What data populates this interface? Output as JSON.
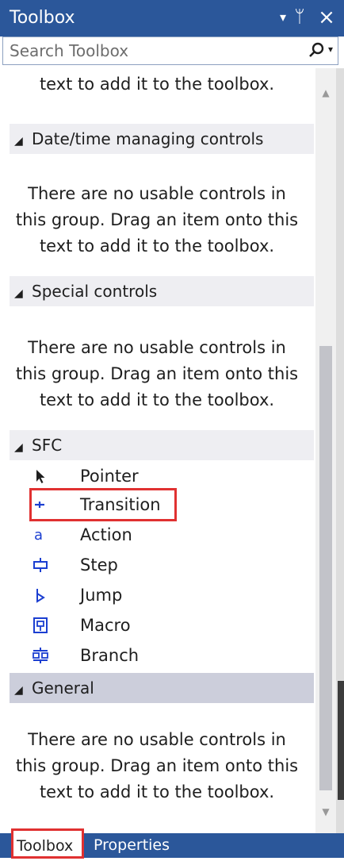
{
  "panel": {
    "title": "Toolbox",
    "menu_icon": "▾",
    "pin_icon": "ᛘ",
    "close_icon": "×"
  },
  "search": {
    "placeholder": "Search Toolbox",
    "value": ""
  },
  "content": {
    "top_message_partial": "text to add it to the toolbox.",
    "groups": [
      {
        "name": "Date/time managing controls",
        "expanded": true,
        "message_lines": [
          "There are no usable controls in",
          "this group. Drag an item onto this",
          "text to add it to the toolbox."
        ]
      },
      {
        "name": "Special controls",
        "expanded": true,
        "message_lines": [
          "There are no usable controls in",
          "this group. Drag an item onto this",
          "text to add it to the toolbox."
        ]
      },
      {
        "name": "SFC",
        "expanded": true,
        "items": [
          {
            "label": "Pointer",
            "icon": "pointer-icon"
          },
          {
            "label": "Transition",
            "icon": "transition-icon",
            "highlighted": true
          },
          {
            "label": "Action",
            "icon": "action-icon"
          },
          {
            "label": "Step",
            "icon": "step-icon"
          },
          {
            "label": "Jump",
            "icon": "jump-icon"
          },
          {
            "label": "Macro",
            "icon": "macro-icon"
          },
          {
            "label": "Branch",
            "icon": "branch-icon"
          }
        ]
      },
      {
        "name": "General",
        "expanded": true,
        "selected": true,
        "message_lines": [
          "There are no usable controls in",
          "this group. Drag an item onto this",
          "text to add it to the toolbox."
        ]
      }
    ]
  },
  "tabs": [
    {
      "label": "Toolbox",
      "active": true
    },
    {
      "label": "Properties",
      "active": false
    }
  ],
  "colors": {
    "titlebar": "#2b579a",
    "group_header": "#eeeef2",
    "group_header_selected": "#cccedb",
    "icon_blue": "#1c3fd1",
    "highlight_red": "#e03131"
  }
}
